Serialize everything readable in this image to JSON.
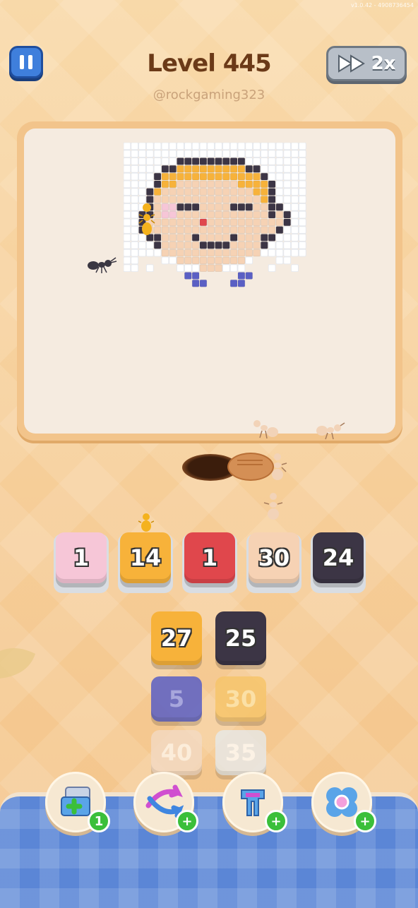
{
  "version": "v1.0.42 - 4908736454",
  "header": {
    "title": "Level 445",
    "username": "@rockgaming323",
    "speed_label": "2x"
  },
  "colors": {
    "pink": "#f6c6d7",
    "yellow": "#f7b23a",
    "red": "#e0474c",
    "skin": "#f6d2b4",
    "dark": "#3c3545",
    "indigo": "#5a5fc4",
    "beige_faded": "#f3dbc6",
    "grey_faded": "#e6ebee",
    "pale_yellow": "#f7c56b"
  },
  "slots": [
    {
      "value": "1",
      "color": "pink"
    },
    {
      "value": "14",
      "color": "yellow"
    },
    {
      "value": "1",
      "color": "red"
    },
    {
      "value": "30",
      "color": "skin"
    },
    {
      "value": "24",
      "color": "dark"
    }
  ],
  "queue": [
    {
      "value": "27",
      "color": "yellow"
    },
    {
      "value": "25",
      "color": "dark"
    },
    {
      "value": "5",
      "color": "indigo"
    },
    {
      "value": "30",
      "color": "pale_yellow"
    },
    {
      "value": "40",
      "color": "beige_faded"
    },
    {
      "value": "35",
      "color": "grey_faded"
    }
  ],
  "powerups": [
    {
      "name": "add-slot-powerup",
      "badge": "1",
      "icon": "add-box-icon"
    },
    {
      "name": "shuffle-powerup",
      "badge": "+",
      "icon": "shuffle-arrow-icon"
    },
    {
      "name": "magnet-powerup",
      "badge": "+",
      "icon": "magnet-icon"
    },
    {
      "name": "flower-powerup",
      "badge": "+",
      "icon": "flower-icon"
    }
  ]
}
